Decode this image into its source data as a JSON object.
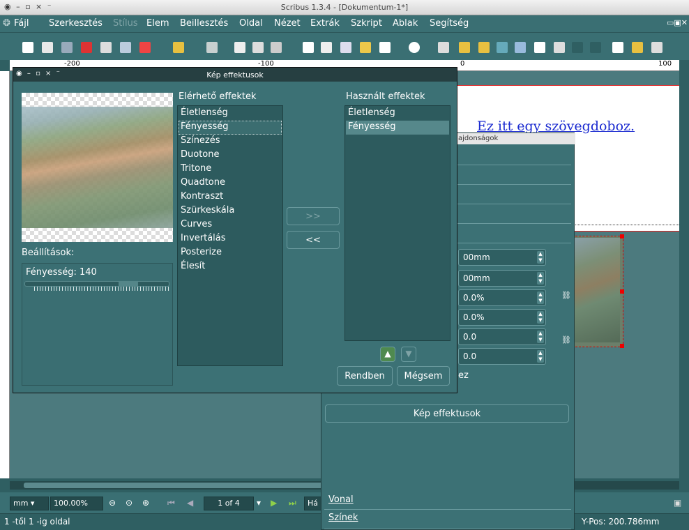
{
  "window": {
    "title": "Scribus 1.3.4 - [Dokumentum-1*]"
  },
  "menu": [
    "Fájl",
    "Szerkesztés",
    "Stílus",
    "Elem",
    "Beillesztés",
    "Oldal",
    "Nézet",
    "Extrák",
    "Szkript",
    "Ablak",
    "Segítség"
  ],
  "ruler": {
    "left": "-200",
    "mid": "-100",
    "zero": "0",
    "right": "100"
  },
  "canvas": {
    "textbox_text": "Ez itt egy szövegdoboz."
  },
  "dialog": {
    "title": "Kép effektusok",
    "available_label": "Elérhető effektek",
    "used_label": "Használt effektek",
    "available": [
      "Életlenség",
      "Fényesség",
      "Színezés",
      "Duotone",
      "Tritone",
      "Quadtone",
      "Kontraszt",
      "Szürkeskála",
      "Curves",
      "Invertálás",
      "Posterize",
      "Élesít"
    ],
    "used": [
      "Életlenség",
      "Fényesség"
    ],
    "add_label": ">>",
    "remove_label": "<<",
    "settings_label": "Beállítások:",
    "brightness_label": "Fényesség: 140",
    "ok_label": "Rendben",
    "cancel_label": "Mégsem"
  },
  "props": {
    "title": "ajdonságok",
    "fields": [
      "00mm",
      "00mm",
      "0.0%",
      "0.0%",
      "0.0",
      "0.0"
    ],
    "checkbox_partial": "ez",
    "effects_button": "Kép effektusok",
    "line_label": "Vonal",
    "colors_label": "Színek"
  },
  "statusbar": {
    "unit": "mm",
    "zoom": "100.00%",
    "page": "1 of 4",
    "layer_partial": "Há",
    "page_status": "1 -től 1 -ig oldal",
    "ypos": "Y-Pos: 200.786mm"
  }
}
